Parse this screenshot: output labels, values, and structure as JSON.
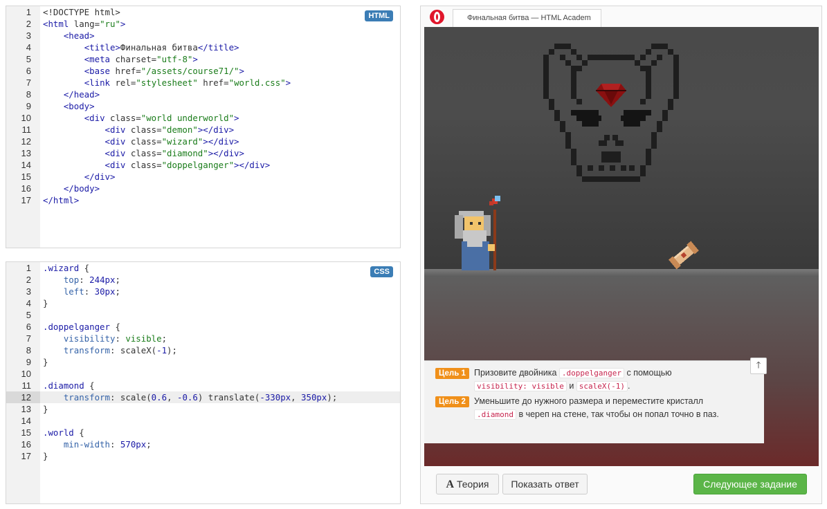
{
  "html_editor": {
    "badge": "HTML",
    "lines": [
      {
        "n": "1",
        "segs": [
          {
            "c": "",
            "t": "<!DOCTYPE html>"
          }
        ]
      },
      {
        "n": "2",
        "segs": [
          {
            "c": "t-tag",
            "t": "<html"
          },
          {
            "c": "",
            "t": " lang="
          },
          {
            "c": "t-str",
            "t": "\"ru\""
          },
          {
            "c": "t-tag",
            "t": ">"
          }
        ]
      },
      {
        "n": "3",
        "segs": [
          {
            "c": "",
            "t": "    "
          },
          {
            "c": "t-tag",
            "t": "<head>"
          }
        ]
      },
      {
        "n": "4",
        "segs": [
          {
            "c": "",
            "t": "        "
          },
          {
            "c": "t-tag",
            "t": "<title>"
          },
          {
            "c": "",
            "t": "Финальная битва"
          },
          {
            "c": "t-tag",
            "t": "</title>"
          }
        ]
      },
      {
        "n": "5",
        "segs": [
          {
            "c": "",
            "t": "        "
          },
          {
            "c": "t-tag",
            "t": "<meta"
          },
          {
            "c": "",
            "t": " charset="
          },
          {
            "c": "t-str",
            "t": "\"utf-8\""
          },
          {
            "c": "t-tag",
            "t": ">"
          }
        ]
      },
      {
        "n": "6",
        "segs": [
          {
            "c": "",
            "t": "        "
          },
          {
            "c": "t-tag",
            "t": "<base"
          },
          {
            "c": "",
            "t": " href="
          },
          {
            "c": "t-str",
            "t": "\"/assets/course71/\""
          },
          {
            "c": "t-tag",
            "t": ">"
          }
        ]
      },
      {
        "n": "7",
        "segs": [
          {
            "c": "",
            "t": "        "
          },
          {
            "c": "t-tag",
            "t": "<link"
          },
          {
            "c": "",
            "t": " rel="
          },
          {
            "c": "t-str",
            "t": "\"stylesheet\""
          },
          {
            "c": "",
            "t": " href="
          },
          {
            "c": "t-str",
            "t": "\"world.css\""
          },
          {
            "c": "t-tag",
            "t": ">"
          }
        ]
      },
      {
        "n": "8",
        "segs": [
          {
            "c": "",
            "t": "    "
          },
          {
            "c": "t-tag",
            "t": "</head>"
          }
        ]
      },
      {
        "n": "9",
        "segs": [
          {
            "c": "",
            "t": "    "
          },
          {
            "c": "t-tag",
            "t": "<body>"
          }
        ]
      },
      {
        "n": "10",
        "segs": [
          {
            "c": "",
            "t": "        "
          },
          {
            "c": "t-tag",
            "t": "<div"
          },
          {
            "c": "",
            "t": " class="
          },
          {
            "c": "t-str",
            "t": "\"world underworld\""
          },
          {
            "c": "t-tag",
            "t": ">"
          }
        ]
      },
      {
        "n": "11",
        "segs": [
          {
            "c": "",
            "t": "            "
          },
          {
            "c": "t-tag",
            "t": "<div"
          },
          {
            "c": "",
            "t": " class="
          },
          {
            "c": "t-str",
            "t": "\"demon\""
          },
          {
            "c": "t-tag",
            "t": "></div>"
          }
        ]
      },
      {
        "n": "12",
        "segs": [
          {
            "c": "",
            "t": "            "
          },
          {
            "c": "t-tag",
            "t": "<div"
          },
          {
            "c": "",
            "t": " class="
          },
          {
            "c": "t-str",
            "t": "\"wizard\""
          },
          {
            "c": "t-tag",
            "t": "></div>"
          }
        ]
      },
      {
        "n": "13",
        "segs": [
          {
            "c": "",
            "t": "            "
          },
          {
            "c": "t-tag",
            "t": "<div"
          },
          {
            "c": "",
            "t": " class="
          },
          {
            "c": "t-str",
            "t": "\"diamond\""
          },
          {
            "c": "t-tag",
            "t": "></div>"
          }
        ]
      },
      {
        "n": "14",
        "segs": [
          {
            "c": "",
            "t": "            "
          },
          {
            "c": "t-tag",
            "t": "<div"
          },
          {
            "c": "",
            "t": " class="
          },
          {
            "c": "t-str",
            "t": "\"doppelganger\""
          },
          {
            "c": "t-tag",
            "t": "></div>"
          }
        ]
      },
      {
        "n": "15",
        "segs": [
          {
            "c": "",
            "t": "        "
          },
          {
            "c": "t-tag",
            "t": "</div>"
          }
        ]
      },
      {
        "n": "16",
        "segs": [
          {
            "c": "",
            "t": "    "
          },
          {
            "c": "t-tag",
            "t": "</body>"
          }
        ]
      },
      {
        "n": "17",
        "segs": [
          {
            "c": "t-tag",
            "t": "</html>"
          }
        ]
      }
    ]
  },
  "css_editor": {
    "badge": "CSS",
    "active_line": "12",
    "lines": [
      {
        "n": "1",
        "segs": [
          {
            "c": "t-sel",
            "t": ".wizard"
          },
          {
            "c": "",
            "t": " {"
          }
        ]
      },
      {
        "n": "2",
        "segs": [
          {
            "c": "",
            "t": "    "
          },
          {
            "c": "t-prop",
            "t": "top"
          },
          {
            "c": "",
            "t": ": "
          },
          {
            "c": "t-num",
            "t": "244px"
          },
          {
            "c": "",
            "t": ";"
          }
        ]
      },
      {
        "n": "3",
        "segs": [
          {
            "c": "",
            "t": "    "
          },
          {
            "c": "t-prop",
            "t": "left"
          },
          {
            "c": "",
            "t": ": "
          },
          {
            "c": "t-num",
            "t": "30px"
          },
          {
            "c": "",
            "t": ";"
          }
        ]
      },
      {
        "n": "4",
        "segs": [
          {
            "c": "",
            "t": "}"
          }
        ]
      },
      {
        "n": "5",
        "segs": [
          {
            "c": "",
            "t": ""
          }
        ]
      },
      {
        "n": "6",
        "segs": [
          {
            "c": "t-sel",
            "t": ".doppelganger"
          },
          {
            "c": "",
            "t": " {"
          }
        ]
      },
      {
        "n": "7",
        "segs": [
          {
            "c": "",
            "t": "    "
          },
          {
            "c": "t-prop",
            "t": "visibility"
          },
          {
            "c": "",
            "t": ": "
          },
          {
            "c": "t-kw",
            "t": "visible"
          },
          {
            "c": "",
            "t": ";"
          }
        ]
      },
      {
        "n": "8",
        "segs": [
          {
            "c": "",
            "t": "    "
          },
          {
            "c": "t-prop",
            "t": "transform"
          },
          {
            "c": "",
            "t": ": scaleX("
          },
          {
            "c": "t-num",
            "t": "-1"
          },
          {
            "c": "",
            "t": ");"
          }
        ]
      },
      {
        "n": "9",
        "segs": [
          {
            "c": "",
            "t": "}"
          }
        ]
      },
      {
        "n": "10",
        "segs": [
          {
            "c": "",
            "t": ""
          }
        ]
      },
      {
        "n": "11",
        "segs": [
          {
            "c": "t-sel",
            "t": ".diamond"
          },
          {
            "c": "",
            "t": " {"
          }
        ]
      },
      {
        "n": "12",
        "segs": [
          {
            "c": "",
            "t": "    "
          },
          {
            "c": "t-prop",
            "t": "transform"
          },
          {
            "c": "",
            "t": ": scale("
          },
          {
            "c": "t-num",
            "t": "0.6"
          },
          {
            "c": "",
            "t": ", "
          },
          {
            "c": "t-num",
            "t": "-0.6"
          },
          {
            "c": "",
            "t": ") translate("
          },
          {
            "c": "t-num",
            "t": "-330px"
          },
          {
            "c": "",
            "t": ", "
          },
          {
            "c": "t-num",
            "t": "350px"
          },
          {
            "c": "",
            "t": ");"
          }
        ]
      },
      {
        "n": "13",
        "segs": [
          {
            "c": "",
            "t": "}"
          }
        ]
      },
      {
        "n": "14",
        "segs": [
          {
            "c": "",
            "t": ""
          }
        ]
      },
      {
        "n": "15",
        "segs": [
          {
            "c": "t-sel",
            "t": ".world"
          },
          {
            "c": "",
            "t": " {"
          }
        ]
      },
      {
        "n": "16",
        "segs": [
          {
            "c": "",
            "t": "    "
          },
          {
            "c": "t-prop",
            "t": "min-width"
          },
          {
            "c": "",
            "t": ": "
          },
          {
            "c": "t-num",
            "t": "570px"
          },
          {
            "c": "",
            "t": ";"
          }
        ]
      },
      {
        "n": "17",
        "segs": [
          {
            "c": "",
            "t": "}"
          }
        ]
      }
    ]
  },
  "browser": {
    "tab_title": "Финальная битва — HTML Academ"
  },
  "tasks": {
    "goal1_label": "Цель 1",
    "goal1_a": "Призовите двойника",
    "goal1_code1": ".doppelganger",
    "goal1_b": "с помощью",
    "goal1_code2": "visibility: visible",
    "goal1_c": "и",
    "goal1_code3": "scaleX(-1)",
    "goal1_d": ".",
    "goal2_label": "Цель 2",
    "goal2_a": "Уменьшите до нужного размера и переместите кристалл",
    "goal2_code1": ".diamond",
    "goal2_b": "в череп на стене, так чтобы он попал точно в паз.",
    "collapse_arrow": "🡑"
  },
  "buttons": {
    "theory_icon": "A",
    "theory": "Теория",
    "answer": "Показать ответ",
    "next": "Следующее задание"
  },
  "colors": {
    "accent_green": "#5bb548",
    "goal_orange": "#f0901a",
    "badge_blue": "#3b7db5",
    "opera_red": "#e0162b"
  }
}
